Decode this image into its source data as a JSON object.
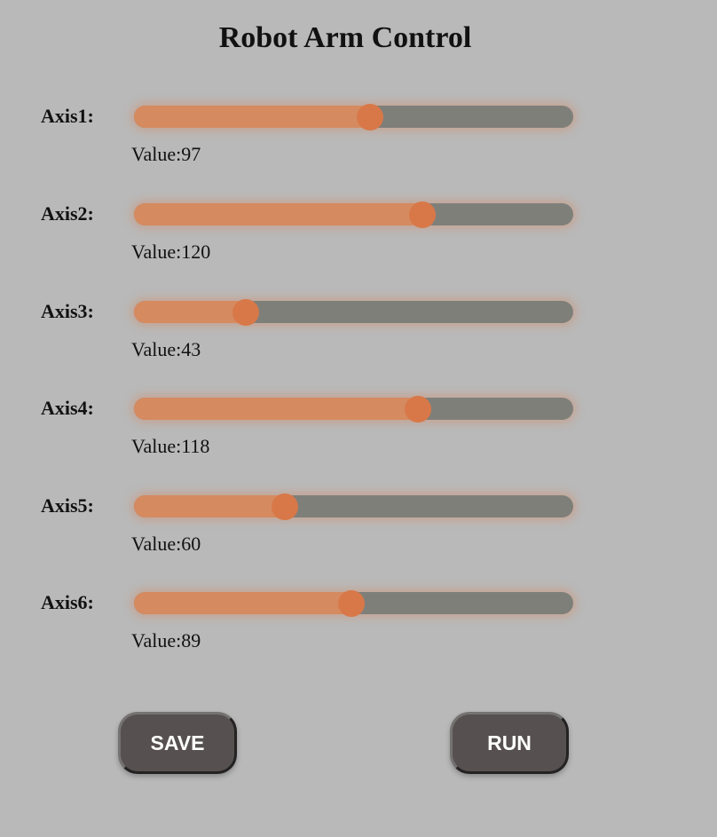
{
  "title": "Robot Arm Control",
  "value_prefix": "Value:",
  "axes": [
    {
      "label": "Axis1:",
      "value": 97
    },
    {
      "label": "Axis2:",
      "value": 120
    },
    {
      "label": "Axis3:",
      "value": 43
    },
    {
      "label": "Axis4:",
      "value": 118
    },
    {
      "label": "Axis5:",
      "value": 60
    },
    {
      "label": "Axis6:",
      "value": 89
    }
  ],
  "slider_max": 180,
  "buttons": {
    "save_label": "SAVE",
    "run_label": "RUN"
  },
  "colors": {
    "background": "#b9b9b9",
    "fill": "#d58a60",
    "thumb": "#d87848",
    "track": "#7f7f7a",
    "button": "#565150"
  }
}
